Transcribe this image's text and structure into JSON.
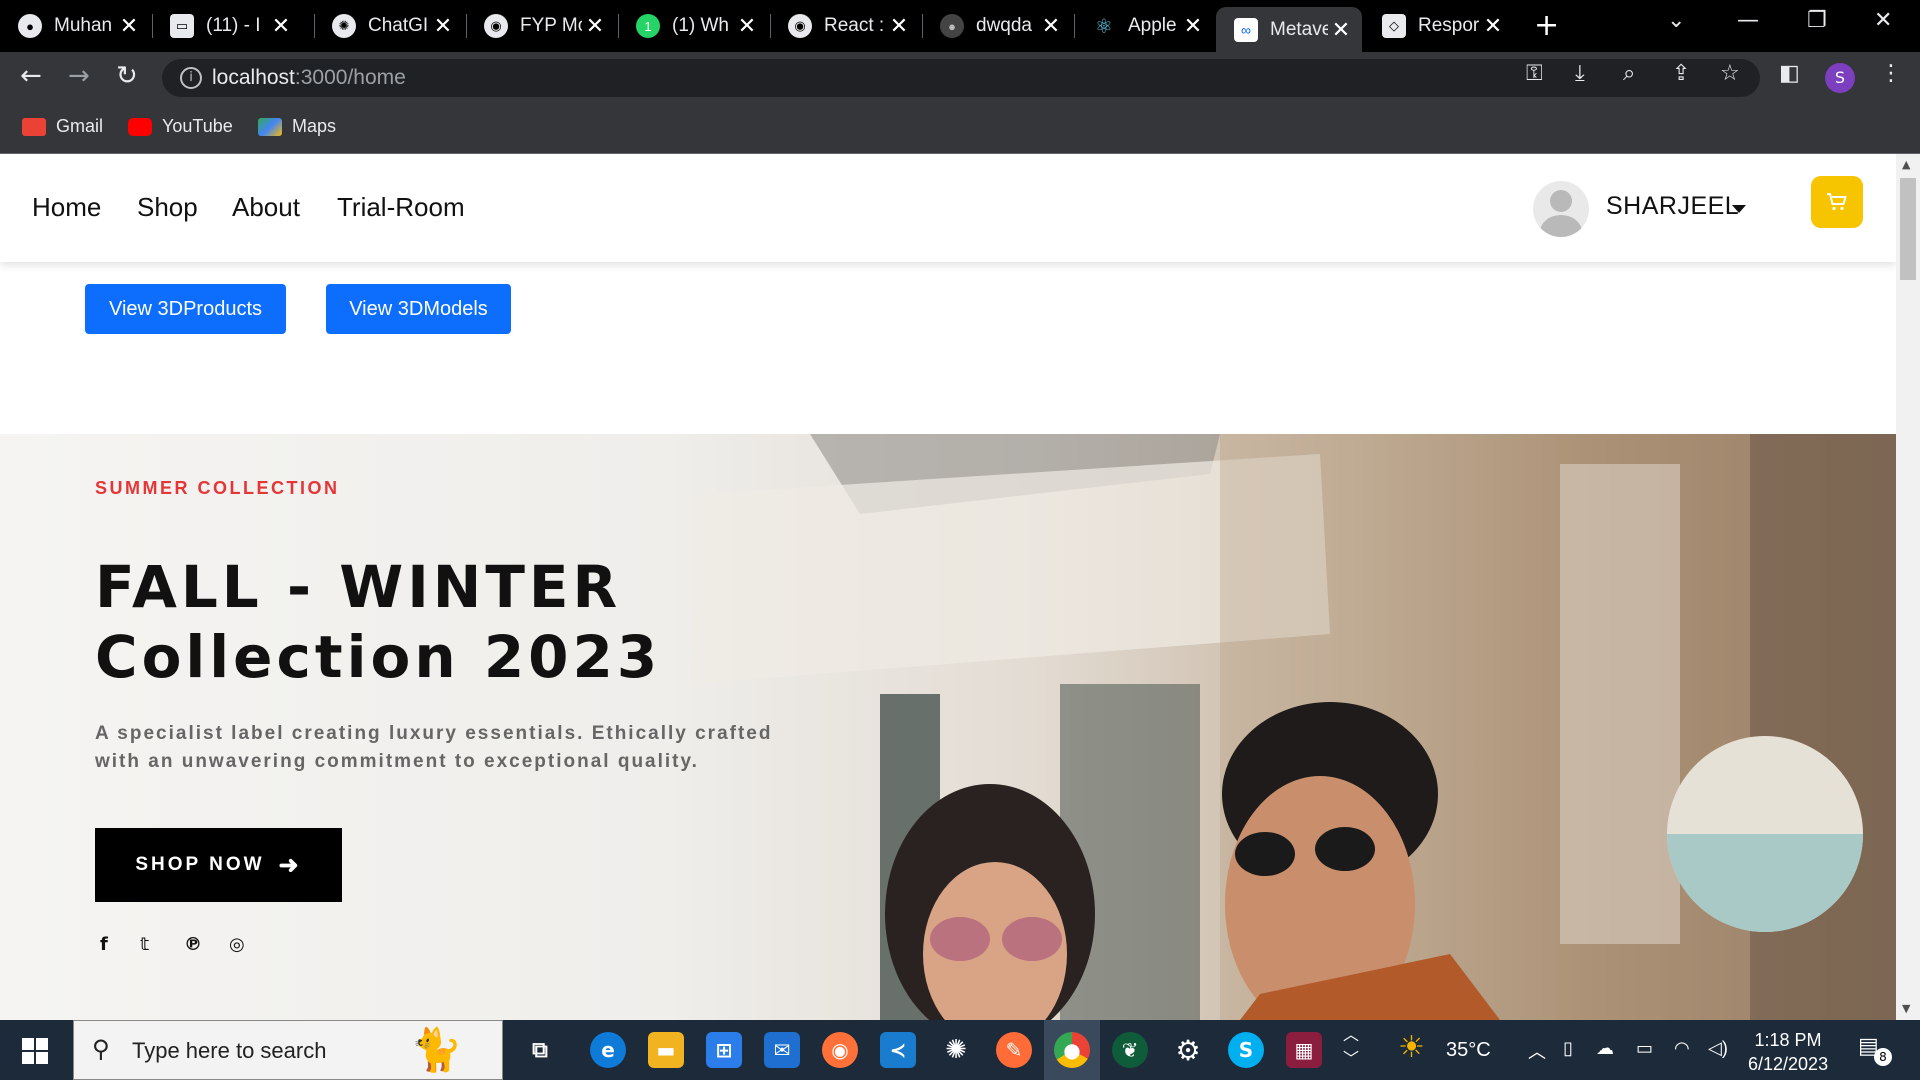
{
  "browser": {
    "tabs": [
      {
        "title": "Muhan",
        "icon": "github-icon",
        "color": "#2b2b2b"
      },
      {
        "title": "(11) - I",
        "icon": "inbox-icon",
        "color": "#7aa7ff"
      },
      {
        "title": "ChatGI",
        "icon": "openai-icon",
        "color": "#19c37d"
      },
      {
        "title": "FYP Mo",
        "icon": "globe-icon",
        "color": "#e8eaed"
      },
      {
        "title": "(1) Wh",
        "icon": "whatsapp-icon",
        "color": "#25d366"
      },
      {
        "title": "React :",
        "icon": "globe-icon",
        "color": "#e8eaed"
      },
      {
        "title": "dwqda",
        "icon": "github-icon",
        "color": "#2b2b2b"
      },
      {
        "title": "Apple",
        "icon": "react-icon",
        "color": "#61dafb"
      },
      {
        "title": "Metave",
        "icon": "meta-icon",
        "color": "#0866ff"
      },
      {
        "title": "Respor",
        "icon": "codepen-icon",
        "color": "#e8eaed"
      }
    ],
    "close_glyph": "✕",
    "new_tab_glyph": "+",
    "url_host": "localhost",
    "url_path": ":3000/home",
    "profile_initial": "S",
    "bookmarks": [
      {
        "label": "Gmail",
        "color": "#ea4335"
      },
      {
        "label": "YouTube",
        "color": "#ff0000"
      },
      {
        "label": "Maps",
        "color": "#34a853"
      }
    ]
  },
  "site": {
    "nav": [
      "Home",
      "Shop",
      "About",
      "Trial-Room"
    ],
    "username": "SHARJEEL",
    "buttons": [
      "View 3DProducts",
      "View 3DModels"
    ],
    "hero": {
      "kicker": "SUMMER COLLECTION",
      "headline_line1": "FALL - WINTER",
      "headline_line2": "Collection 2023",
      "subtext_line1": "A specialist label creating luxury essentials. Ethically crafted",
      "subtext_line2": "with an unwavering commitment to exceptional quality.",
      "cta": "SHOP NOW",
      "social_glyphs": [
        "f",
        "𝕥",
        "℗",
        "◎"
      ]
    },
    "accent_color": "#e53637",
    "button_color": "#0d6efd",
    "cart_color": "#f7c400"
  },
  "taskbar": {
    "search_placeholder": "Type here to search",
    "weather": "35°C",
    "time": "1:18 PM",
    "date": "6/12/2023",
    "notification_count": "8"
  }
}
